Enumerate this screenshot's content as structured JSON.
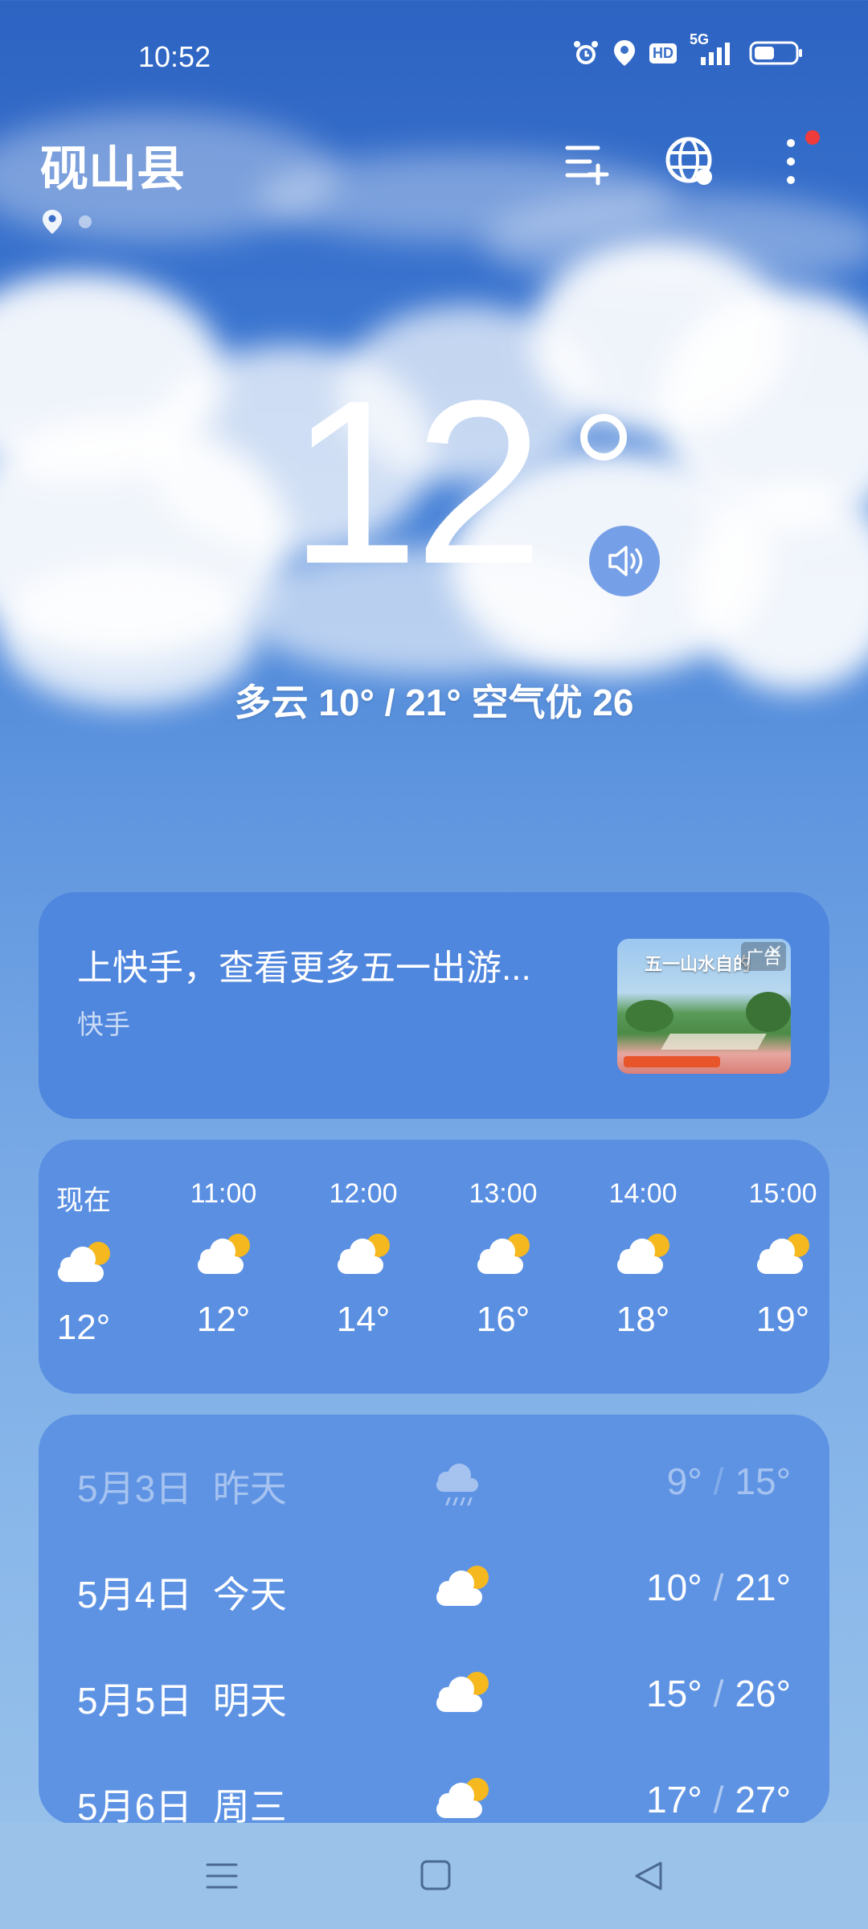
{
  "status_bar": {
    "time": "10:52",
    "icons": [
      "alarm-icon",
      "location-icon",
      "hd-icon",
      "5g-signal-icon",
      "battery-icon"
    ],
    "network_label": "5G",
    "hd_label": "HD"
  },
  "header": {
    "city": "砚山县",
    "actions": [
      "add-city-icon",
      "globe-icon",
      "more-icon"
    ]
  },
  "current": {
    "temperature": "12",
    "summary": "多云  10° / 21°  空气优 26"
  },
  "ad": {
    "title": "上快手，查看更多五一出游...",
    "source": "快手",
    "tag": "广告",
    "image_caption": "五一山水自的"
  },
  "hourly": [
    {
      "time": "现在",
      "temp": "12°",
      "icon": "partly-cloudy-icon"
    },
    {
      "time": "11:00",
      "temp": "12°",
      "icon": "partly-cloudy-icon"
    },
    {
      "time": "12:00",
      "temp": "14°",
      "icon": "partly-cloudy-icon"
    },
    {
      "time": "13:00",
      "temp": "16°",
      "icon": "partly-cloudy-icon"
    },
    {
      "time": "14:00",
      "temp": "18°",
      "icon": "partly-cloudy-icon"
    },
    {
      "time": "15:00",
      "temp": "19°",
      "icon": "partly-cloudy-icon"
    }
  ],
  "daily": [
    {
      "date": "5月3日  昨天",
      "low": "9°",
      "high": "15°",
      "icon": "rain-icon",
      "past": true
    },
    {
      "date": "5月4日  今天",
      "low": "10°",
      "high": "21°",
      "icon": "partly-cloudy-icon",
      "past": false
    },
    {
      "date": "5月5日  明天",
      "low": "15°",
      "high": "26°",
      "icon": "partly-cloudy-icon",
      "past": false
    },
    {
      "date": "5月6日  周三",
      "low": "17°",
      "high": "27°",
      "icon": "partly-cloudy-icon",
      "past": false
    }
  ],
  "nav": [
    "menu-icon",
    "home-icon",
    "back-icon"
  ],
  "colors": {
    "sun": "#f6b81f",
    "notification_dot": "#ef3b3b"
  }
}
